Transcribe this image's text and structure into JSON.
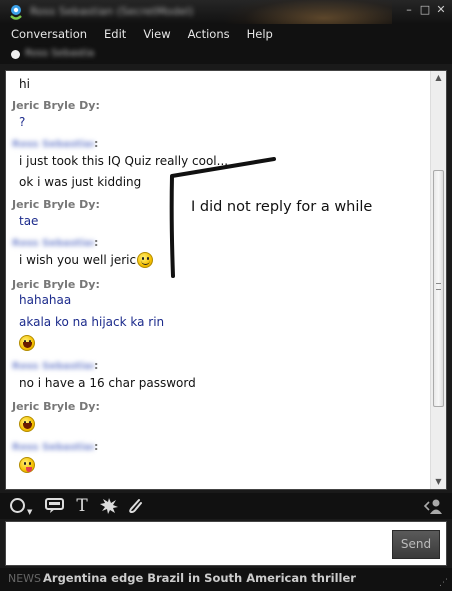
{
  "window": {
    "title": "Ross Sebastian (SecretModel)"
  },
  "menu": [
    "Conversation",
    "Edit",
    "View",
    "Actions",
    "Help"
  ],
  "contact": {
    "name": "Ross Sebastian"
  },
  "conversation": {
    "blurred_sender": "Ross Sebastian",
    "jeric": "Jeric Bryle Dy:",
    "lines": {
      "hi": "hi",
      "q": "?",
      "quiz": "i just took this IQ Quiz really cool...",
      "kidding": "ok i was just kidding",
      "tae": "tae",
      "wish": "i wish you well jeric",
      "hahahaa": "hahahaa",
      "akala": "akala ko na hijack ka rin",
      "password": "no i have a 16 char password"
    },
    "annotation": "I did not reply for a while"
  },
  "toolbar": {
    "icons": [
      "emoticon-icon",
      "wink-icon",
      "text-format-icon",
      "nudge-icon",
      "attachment-icon",
      "contact-card-icon"
    ]
  },
  "input": {
    "send_label": "Send"
  },
  "news": {
    "label": "NEWS",
    "headline": "Argentina edge Brazil in South American thriller"
  },
  "colors": {
    "chrome": "#111111",
    "sender_gray": "#777777",
    "message_blue": "#1c2b8c"
  }
}
